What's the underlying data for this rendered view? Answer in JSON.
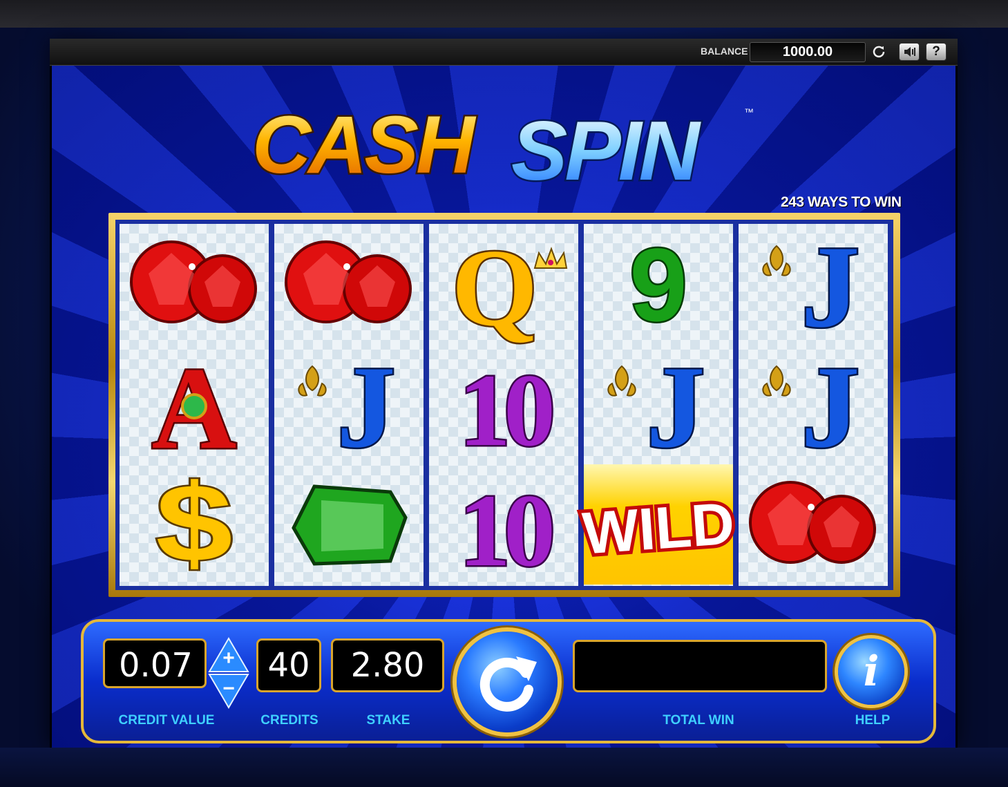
{
  "header": {
    "balance_label": "BALANCE",
    "balance_value": "1000.00"
  },
  "game": {
    "logo_word1": "CASH",
    "logo_word2": "SPIN",
    "logo_tm": "™",
    "ways_to_win": "243 WAYS TO WIN"
  },
  "reels": [
    [
      "red-gems",
      "ace",
      "dollar"
    ],
    [
      "red-gems",
      "jack",
      "emerald"
    ],
    [
      "queen",
      "ten",
      "ten"
    ],
    [
      "nine",
      "jack",
      "wild"
    ],
    [
      "jack",
      "jack",
      "red-gems"
    ]
  ],
  "symbol_text": {
    "ace": "A",
    "jack": "J",
    "queen": "Q",
    "ten": "10",
    "nine": "9",
    "dollar": "$",
    "wild": "WILD"
  },
  "controls": {
    "credit_value": "0.07",
    "credit_value_label": "CREDIT VALUE",
    "credits": "40",
    "credits_label": "CREDITS",
    "stake": "2.80",
    "stake_label": "STAKE",
    "total_win": "",
    "total_win_label": "TOTAL WIN",
    "help_label": "HELP",
    "help_glyph": "i",
    "plus": "+",
    "minus": "−"
  },
  "colors": {
    "gold": "#f0c243",
    "label_cyan": "#3fd0ff",
    "ruby": "#e01010",
    "emerald": "#1fa61f",
    "jack_blue": "#1457e0",
    "ten_purple": "#a020c8",
    "nine_green": "#18a018",
    "queen_gold": "#ffb800",
    "ace_red": "#d81010"
  }
}
